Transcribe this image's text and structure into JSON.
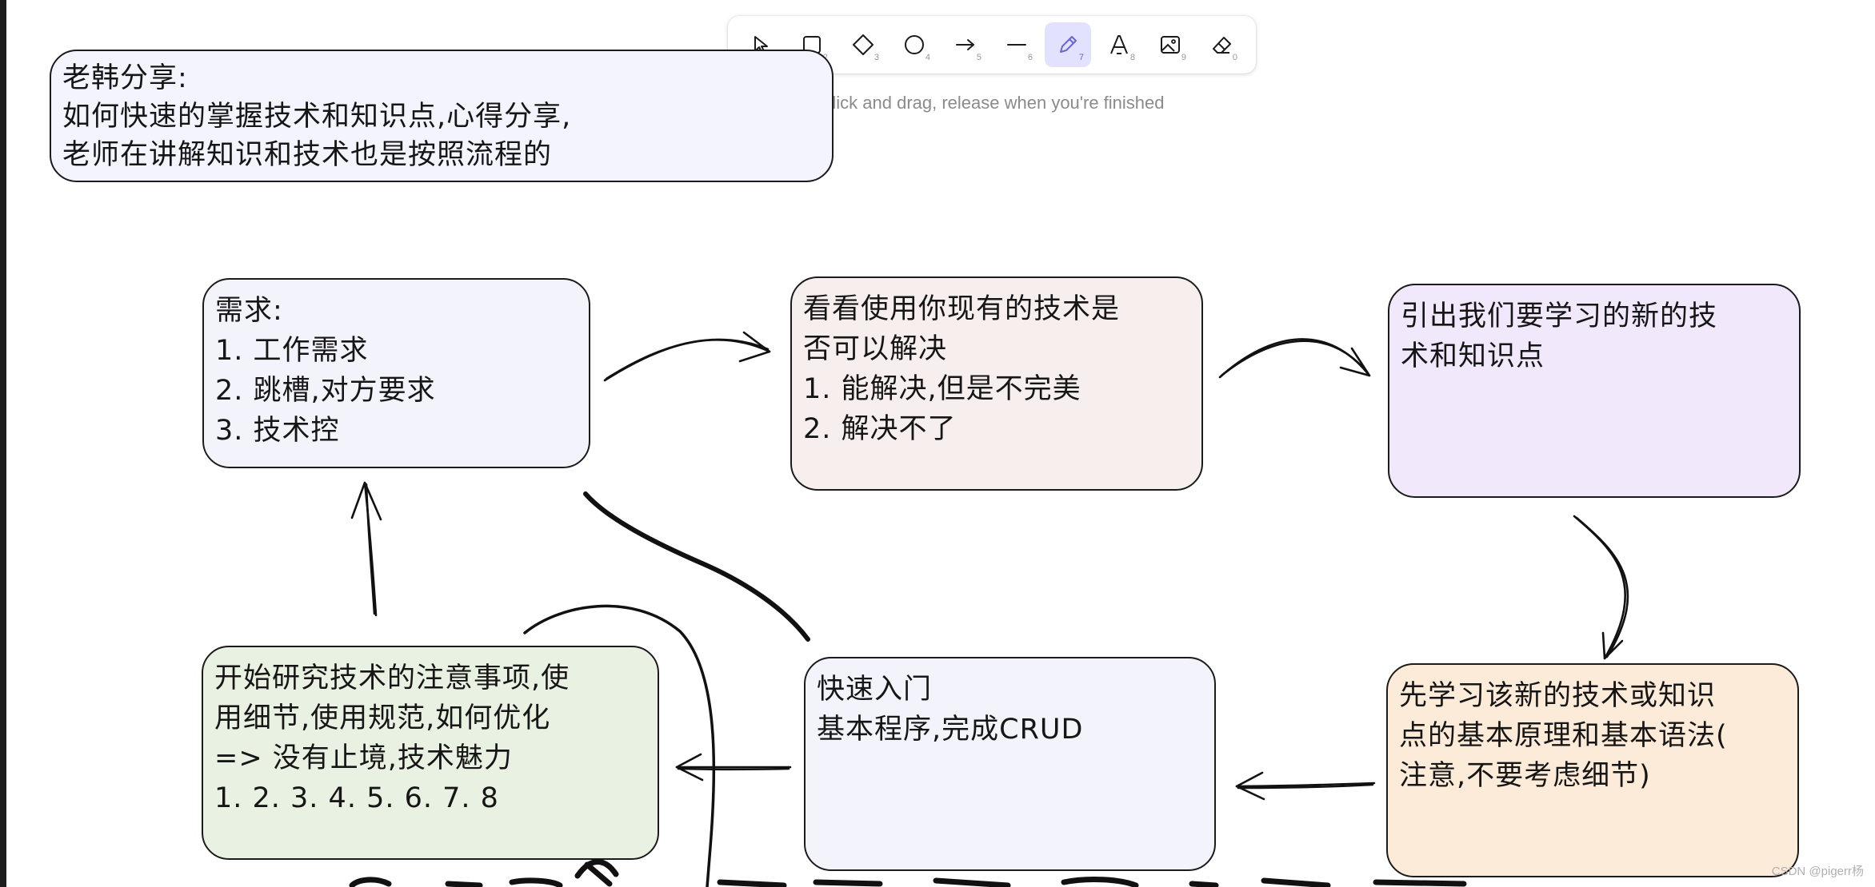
{
  "toolbar": {
    "tools": [
      {
        "name": "selection-tool",
        "icon": "cursor-icon",
        "key": "1",
        "active": false
      },
      {
        "name": "rectangle-tool",
        "icon": "rectangle-icon",
        "key": "2",
        "active": false
      },
      {
        "name": "diamond-tool",
        "icon": "diamond-icon",
        "key": "3",
        "active": false
      },
      {
        "name": "ellipse-tool",
        "icon": "ellipse-icon",
        "key": "4",
        "active": false
      },
      {
        "name": "arrow-tool",
        "icon": "arrow-icon",
        "key": "5",
        "active": false
      },
      {
        "name": "line-tool",
        "icon": "line-icon",
        "key": "6",
        "active": false
      },
      {
        "name": "draw-tool",
        "icon": "pencil-icon",
        "key": "7",
        "active": true
      },
      {
        "name": "text-tool",
        "icon": "text-icon",
        "key": "8",
        "active": false
      },
      {
        "name": "image-tool",
        "icon": "image-icon",
        "key": "9",
        "active": false
      },
      {
        "name": "eraser-tool",
        "icon": "eraser-icon",
        "key": "0",
        "active": false
      }
    ],
    "accent": "#6965db",
    "active_bg": "#e3e2fe"
  },
  "hint": "Click and drag, release when you're finished",
  "boxes": {
    "intro": {
      "lines": [
        "老韩分享:",
        "如何快速的掌握技术和知识点,心得分享,",
        "老师在讲解知识和技术也是按照流程的"
      ],
      "bg": "#f4f4ff"
    },
    "need": {
      "lines": [
        "需求:",
        "1.  工作需求",
        "2.  跳槽,对方要求",
        "3.  技术控"
      ],
      "bg": "#f3f3fb"
    },
    "check": {
      "lines": [
        "看看使用你现有的技术是",
        "否可以解决",
        "1.  能解决,但是不完美",
        "2.  解决不了"
      ],
      "bg": "#f6efee"
    },
    "lead": {
      "lines": [
        "引出我们要学习的新的技",
        "术和知识点"
      ],
      "bg": "#f2e8fb"
    },
    "learn": {
      "lines": [
        "先学习该新的技术或知识",
        "点的基本原理和基本语法(",
        "注意,不要考虑细节)"
      ],
      "bg": "#fdebd9"
    },
    "quick": {
      "lines": [
        "快速入门",
        "基本程序,完成CRUD"
      ],
      "bg": "#f3f4fb"
    },
    "research": {
      "lines": [
        "开始研究技术的注意事项,使",
        "用细节,使用规范,如何优化",
        "=> 没有止境,技术魅力",
        "1.  2.  3.  4.  5.  6.  7.  8"
      ],
      "bg": "#e9f1e2"
    }
  },
  "watermark": "CSDN @pigerr杨"
}
